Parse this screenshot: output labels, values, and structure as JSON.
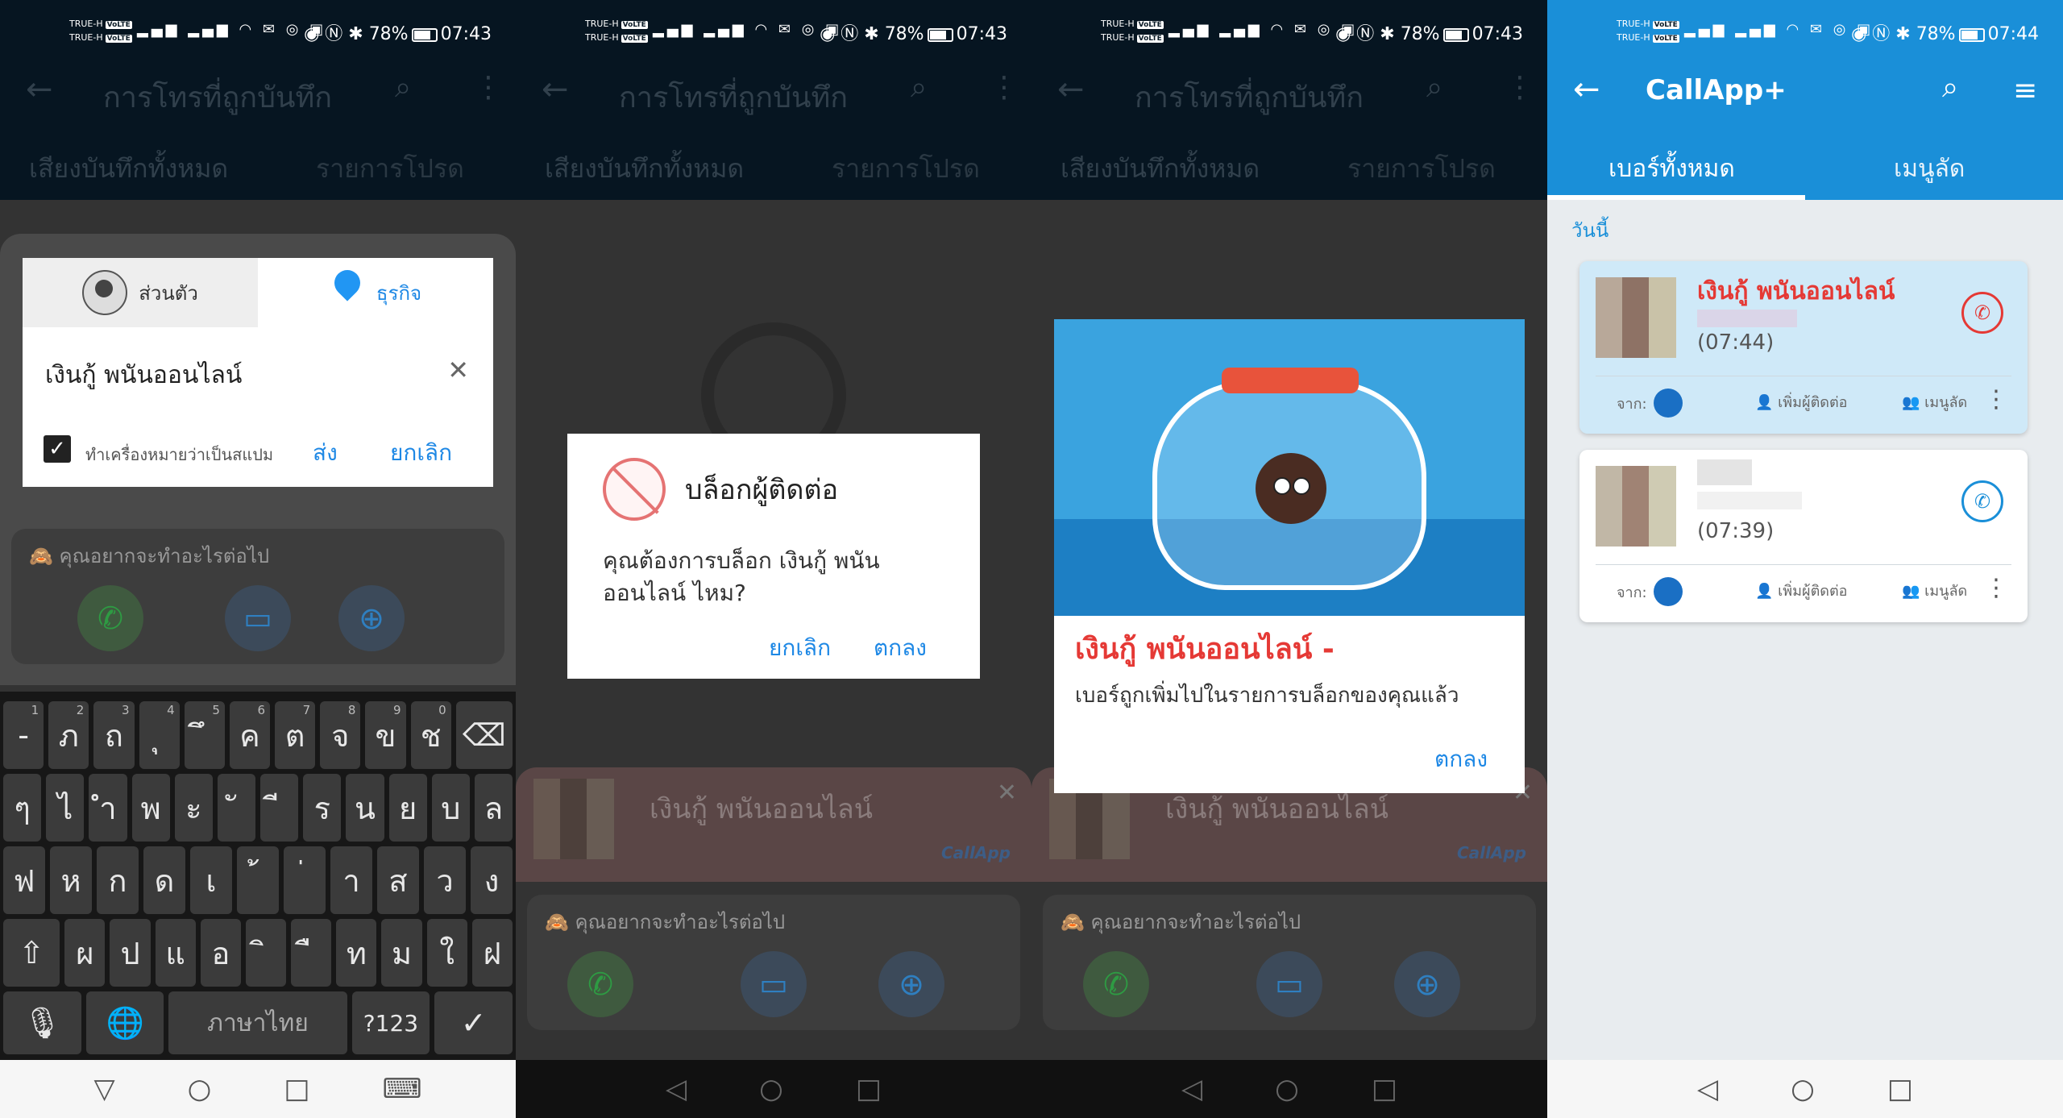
{
  "status": {
    "carrier1": "TRUE-H",
    "carrier2": "TRUE-H",
    "volte": "VoLTE",
    "battery": "78%",
    "time_a": "07:43",
    "time_b": "07:44"
  },
  "recorder": {
    "title": "การโทรที่ถูกบันทึก",
    "tab_all": "เสียงบันทึกทั้งหมด",
    "tab_fav": "รายการโปรด"
  },
  "tag_dialog": {
    "tab_personal": "ส่วนตัว",
    "tab_business": "ธุรกิจ",
    "input_value": "เงินกู้ พนันออนไลน์",
    "spam_label": "ทำเครื่องหมายว่าเป็นสแปม",
    "send": "ส่ง",
    "cancel": "ยกเลิก"
  },
  "what_next": "คุณอยากจะทำอะไรต่อไป",
  "keyboard": {
    "row1": [
      "-",
      "ภ",
      "ถ",
      "ุ",
      "ึ",
      "ค",
      "ต",
      "จ",
      "ข",
      "ช"
    ],
    "row1_sup": [
      "1",
      "2",
      "3",
      "4",
      "5",
      "6",
      "7",
      "8",
      "9",
      "0"
    ],
    "row2": [
      "ๆ",
      "ไ",
      "ำ",
      "พ",
      "ะ",
      "ั",
      "ี",
      "ร",
      "น",
      "ย",
      "บ",
      "ล"
    ],
    "row3": [
      "ฟ",
      "ห",
      "ก",
      "ด",
      "เ",
      "้",
      "่",
      "า",
      "ส",
      "ว",
      "ง"
    ],
    "row4": [
      "ผ",
      "ป",
      "แ",
      "อ",
      "ิ",
      "ื",
      "ท",
      "ม",
      "ใ",
      "ฝ"
    ],
    "space_label": "ภาษาไทย",
    "sym_label": "?123"
  },
  "block_dialog": {
    "title": "บล็อกผู้ติดต่อ",
    "message": "คุณต้องการบล็อก เงินกู้ พนันออนไลน์ ไหม?",
    "cancel": "ยกเลิก",
    "ok": "ตกลง"
  },
  "caller_bar": {
    "name": "เงินกู้ พนันออนไลน์",
    "brand": "CallApp"
  },
  "blocked_dialog": {
    "title": "เงินกู้ พนันออนไลน์ -",
    "message": "เบอร์ถูกเพิ่มไปในรายการบล็อกของคุณแล้ว",
    "ok": "ตกลง"
  },
  "callapp": {
    "title": "CallApp+",
    "tab_all": "เบอร์ทั้งหมด",
    "tab_fav": "เมนูลัด",
    "today": "วันนี้",
    "calls": [
      {
        "name": "เงินกู้ พนันออนไลน์",
        "time": "(07:44)",
        "from": "จาก:",
        "add": "เพิ่มผู้ติดต่อ",
        "fav": "เมนูลัด"
      },
      {
        "name": "",
        "time": "(07:39)",
        "from": "จาก:",
        "add": "เพิ่มผู้ติดต่อ",
        "fav": "เมนูลัด"
      }
    ]
  },
  "colors": {
    "callapp_blue": "#1a8fd8",
    "spam_red": "#e53935",
    "link_blue": "#1e88e5"
  }
}
